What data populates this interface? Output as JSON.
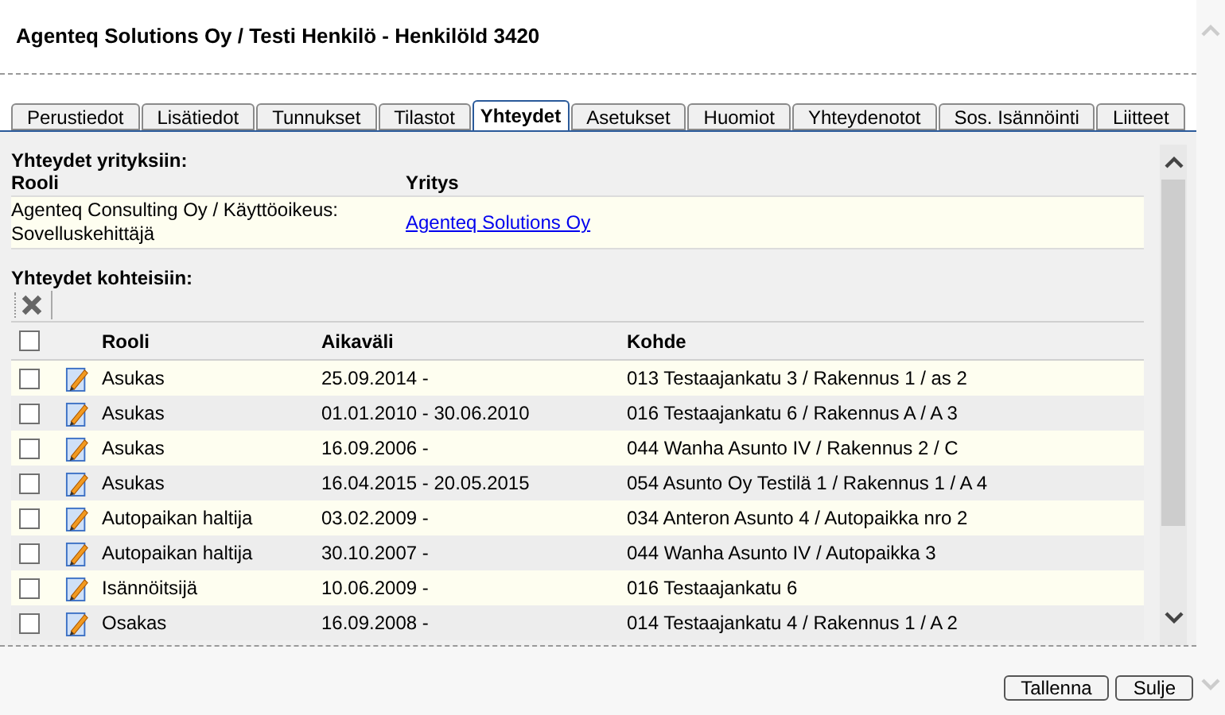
{
  "window": {
    "title": "Agenteq Solutions Oy / Testi Henkilö - Henkilöld 3420"
  },
  "tabs": [
    {
      "label": "Perustiedot",
      "selected": false
    },
    {
      "label": "Lisätiedot",
      "selected": false
    },
    {
      "label": "Tunnukset",
      "selected": false
    },
    {
      "label": "Tilastot",
      "selected": false
    },
    {
      "label": "Yhteydet",
      "selected": true
    },
    {
      "label": "Asetukset",
      "selected": false
    },
    {
      "label": "Huomiot",
      "selected": false
    },
    {
      "label": "Yhteydenotot",
      "selected": false
    },
    {
      "label": "Sos. Isännöinti",
      "selected": false
    },
    {
      "label": "Liitteet",
      "selected": false
    }
  ],
  "companies": {
    "heading": "Yhteydet yrityksiin:",
    "columns": [
      "Rooli",
      "Yritys"
    ],
    "rows": [
      {
        "role": "Agenteq Consulting Oy / Käyttöoikeus: Sovelluskehittäjä",
        "company": "Agenteq Solutions Oy"
      }
    ]
  },
  "targets": {
    "heading": "Yhteydet kohteisiin:",
    "columns": [
      "Rooli",
      "Aikaväli",
      "Kohde"
    ],
    "all_checked": false,
    "rows": [
      {
        "checked": false,
        "role": "Asukas",
        "period": "25.09.2014 -",
        "target": "013 Testaajankatu 3 / Rakennus 1 / as 2"
      },
      {
        "checked": false,
        "role": "Asukas",
        "period": "01.01.2010 - 30.06.2010",
        "target": "016 Testaajankatu 6 / Rakennus A / A 3"
      },
      {
        "checked": false,
        "role": "Asukas",
        "period": "16.09.2006 -",
        "target": "044 Wanha Asunto IV / Rakennus 2 / C"
      },
      {
        "checked": false,
        "role": "Asukas",
        "period": "16.04.2015 - 20.05.2015",
        "target": "054 Asunto Oy Testilä 1 / Rakennus 1 / A 4"
      },
      {
        "checked": false,
        "role": "Autopaikan haltija",
        "period": "03.02.2009 -",
        "target": "034 Anteron Asunto 4 / Autopaikka nro 2"
      },
      {
        "checked": false,
        "role": "Autopaikan haltija",
        "period": "30.10.2007 -",
        "target": "044 Wanha Asunto IV / Autopaikka 3"
      },
      {
        "checked": false,
        "role": "Isännöitsijä",
        "period": "10.06.2009 -",
        "target": "016 Testaajankatu 6"
      },
      {
        "checked": false,
        "role": "Osakas",
        "period": "16.09.2008 -",
        "target": "014 Testaajankatu 4 / Rakennus 1 / A 2"
      }
    ]
  },
  "buttons": [
    "Tallenna",
    "Sulje"
  ]
}
